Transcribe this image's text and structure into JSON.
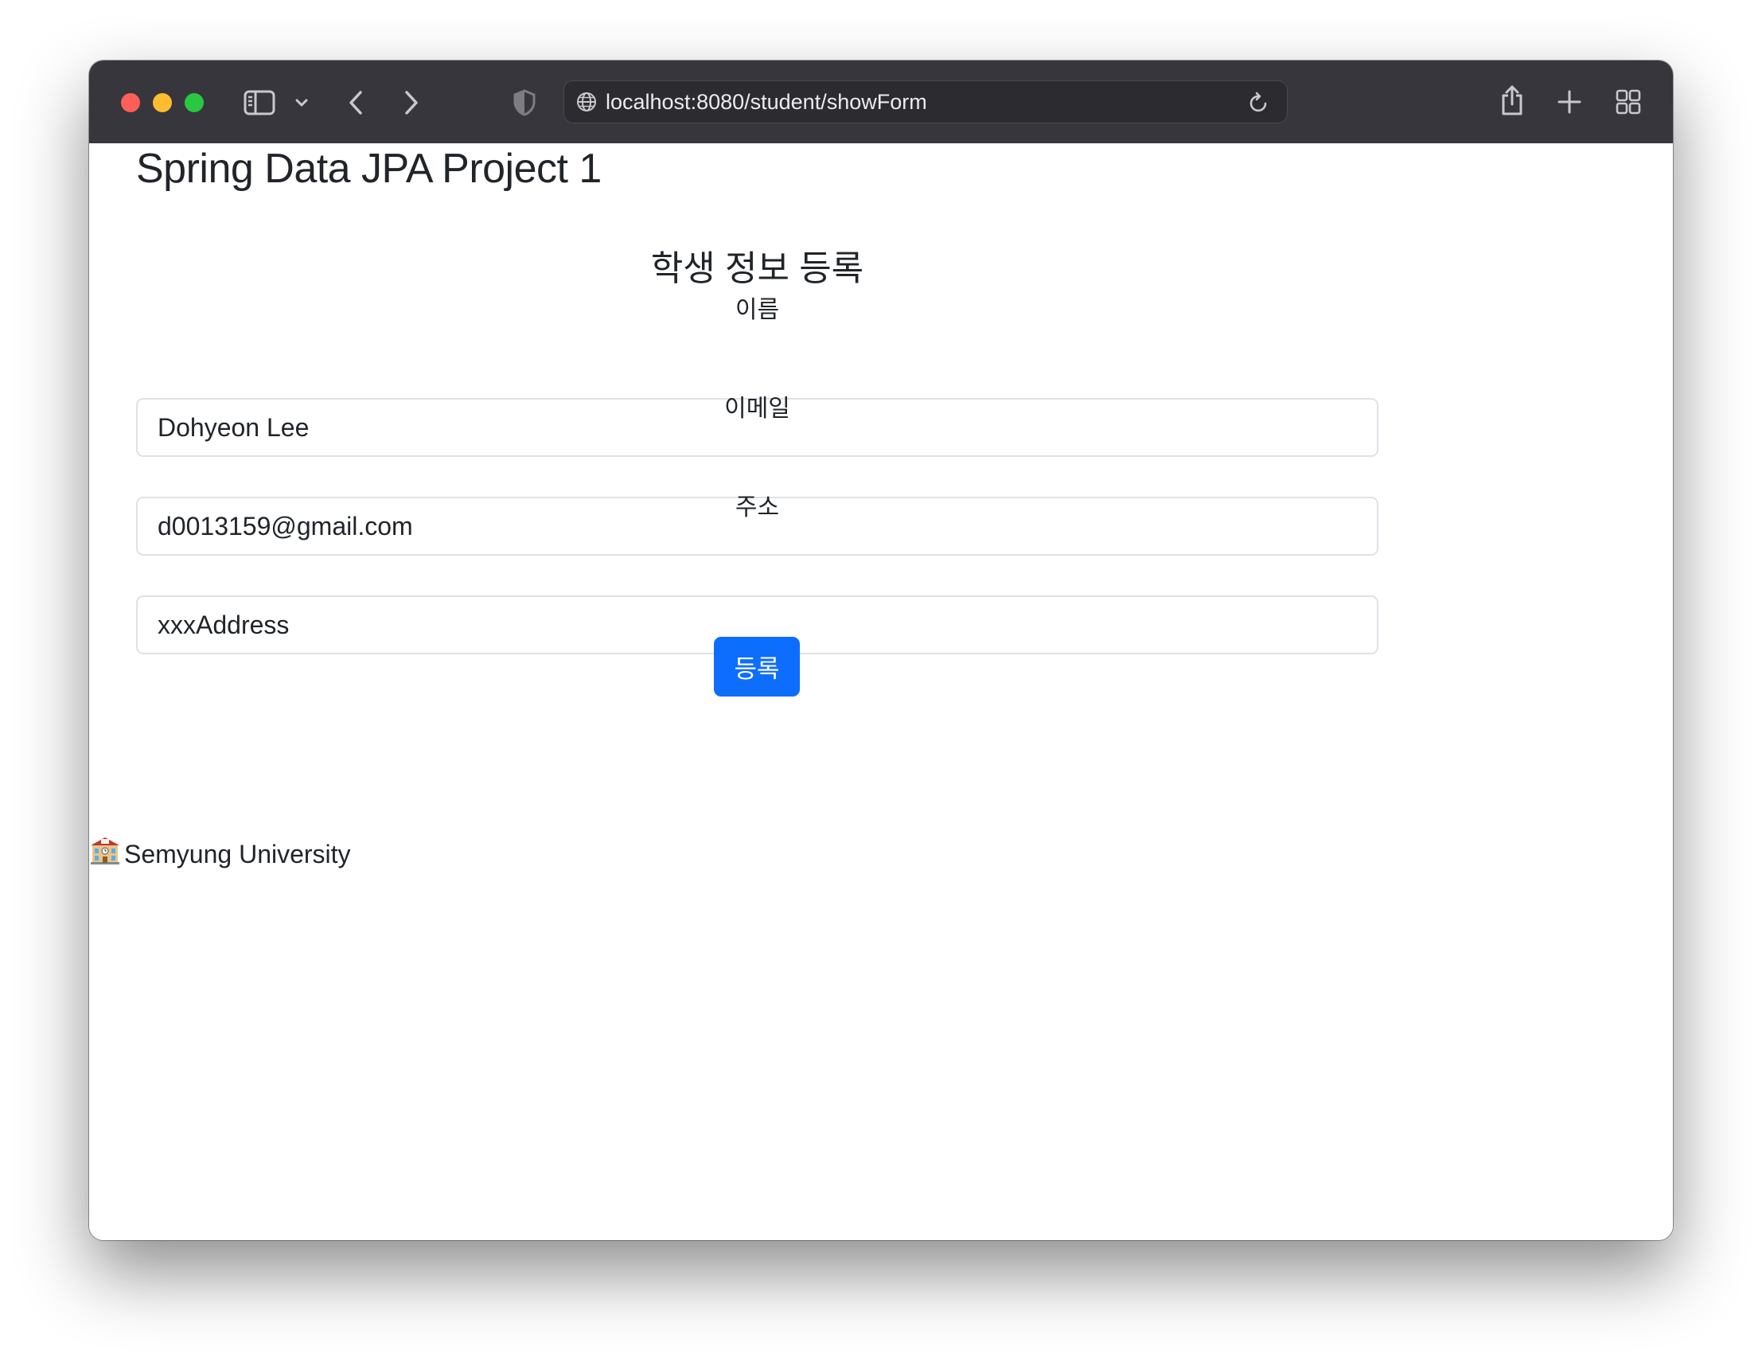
{
  "browser": {
    "url": "localhost:8080/student/showForm",
    "colors": {
      "close": "#fe5f57",
      "minimize": "#febc2e",
      "zoom": "#28c840",
      "toolbar": "#37363c"
    }
  },
  "page": {
    "title": "Spring Data JPA Project 1",
    "form": {
      "heading": "학생 정보 등록",
      "fields": [
        {
          "label": "이름",
          "value": "Dohyeon Lee"
        },
        {
          "label": "이메일",
          "value": "d0013159@gmail.com"
        },
        {
          "label": "주소",
          "value": "xxxAddress"
        }
      ],
      "submit_label": "등록",
      "submit_color": "#0d6efd"
    },
    "footer": {
      "icon": "school-icon",
      "text": "Semyung University"
    }
  }
}
